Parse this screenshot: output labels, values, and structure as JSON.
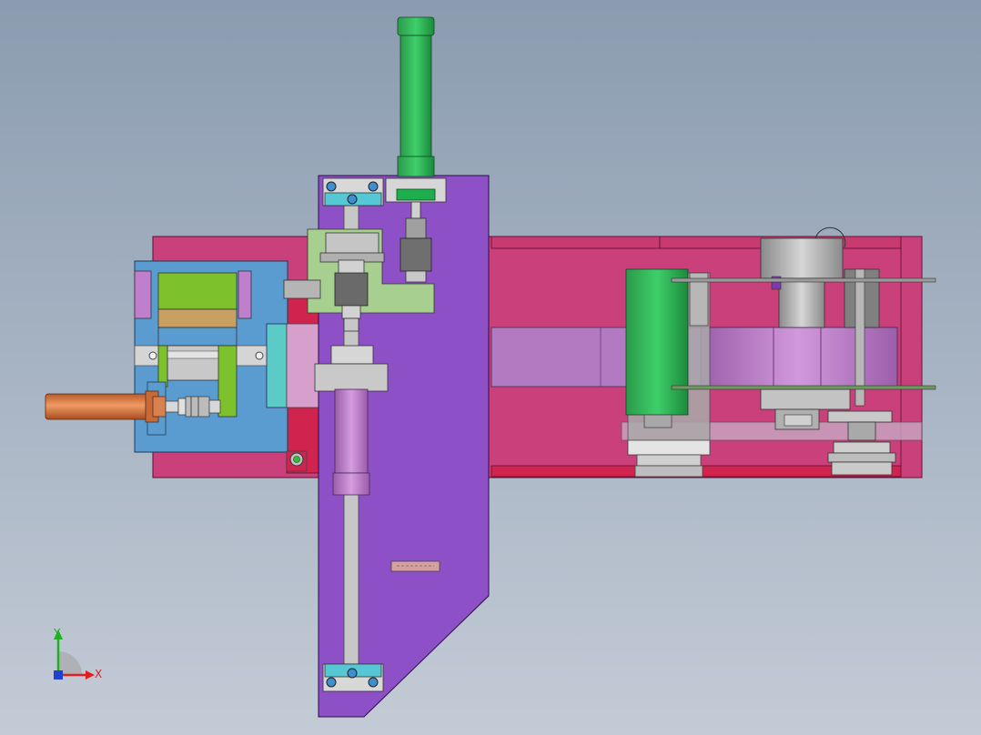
{
  "colors": {
    "background_top": "#8b9cb0",
    "background_bottom": "#c3cbd6",
    "base_plate": "#c9407a",
    "base_plate_dark": "#d0244e",
    "purple_plate": "#8e50c7",
    "left_block": "#5a9bd0",
    "green_cylinder": "#1fae4e",
    "orange_rod": "#d8723f",
    "mauve_body": "#c07fcc",
    "light_green_bracket": "#a7cf8f",
    "cyan_clamp": "#56c7d4",
    "lime_block": "#7dc12c",
    "tan_block": "#c8a062",
    "grey_metal": "#b9b9b9",
    "teal_plate": "#5ccac7",
    "pink_panel": "#d7a0cc"
  },
  "triad": {
    "x_label": "X",
    "y_label": "Y",
    "x_color": "#e02020",
    "y_color": "#20b020",
    "z_color": "#2040d0"
  }
}
